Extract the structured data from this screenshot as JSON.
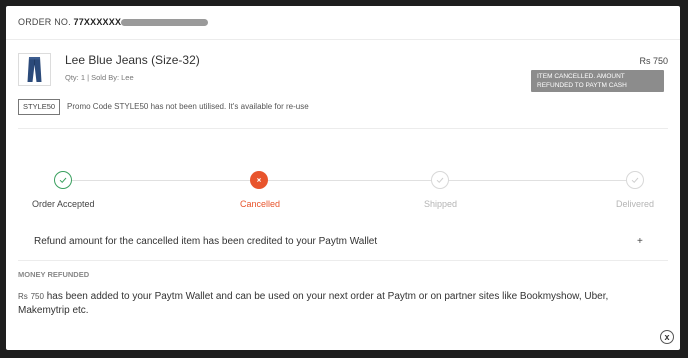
{
  "order": {
    "label": "ORDER NO.",
    "number": "77XXXXXX"
  },
  "item": {
    "icon": "jeans-thumbnail",
    "name": "Lee Blue Jeans (Size-32)",
    "meta": "Qty: 1 | Sold By: Lee",
    "price_currency": "Rs",
    "price_value": "750",
    "status": "ITEM CANCELLED. AMOUNT REFUNDED TO PAYTM CASH"
  },
  "promo": {
    "code": "STYLE50",
    "note": "Promo Code STYLE50 has not been utilised. It's available for re-use"
  },
  "tracker": {
    "steps": [
      {
        "label": "Order Accepted",
        "state": "done",
        "icon": "check-icon"
      },
      {
        "label": "Cancelled",
        "state": "cancelled",
        "icon": "cross-icon"
      },
      {
        "label": "Shipped",
        "state": "pending",
        "icon": "check-icon"
      },
      {
        "label": "Delivered",
        "state": "pending",
        "icon": "check-icon"
      }
    ]
  },
  "refund": {
    "row_text": "Refund amount for the cancelled item has been credited to your Paytm Wallet",
    "expand_symbol": "+",
    "heading": "MONEY REFUNDED",
    "currency": "Rs",
    "amount": "750",
    "message": "has been added to your Paytm Wallet and can be used on your next order at Paytm or on partner sites like Bookmyshow, Uber, Makemytrip etc."
  },
  "close_symbol": "x",
  "colors": {
    "success": "#3aa05f",
    "cancelled": "#e8542c",
    "pending": "#d8d8d8",
    "badge": "#8c8c8c"
  }
}
